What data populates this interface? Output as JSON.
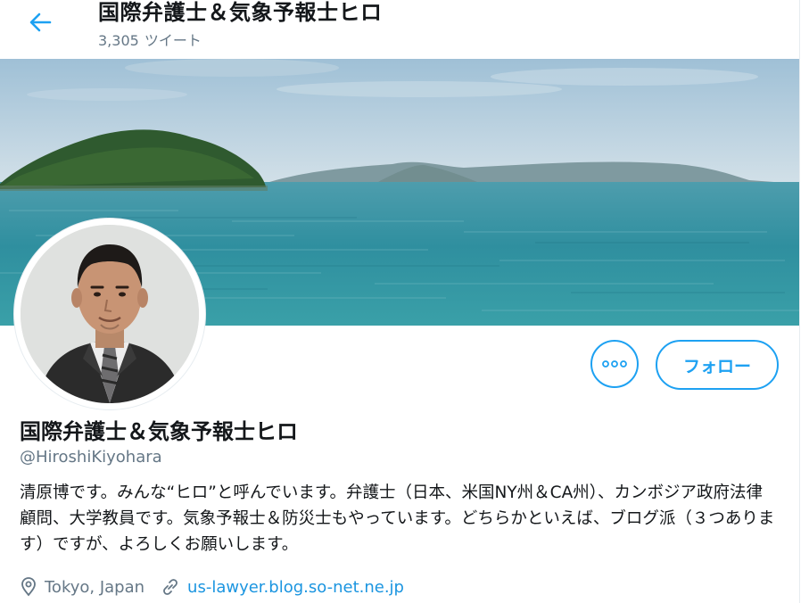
{
  "header": {
    "title": "国際弁護士＆気象予報士ヒロ",
    "tweet_count": "3,305",
    "tweet_label": "ツイート"
  },
  "profile": {
    "name": "国際弁護士＆気象予報士ヒロ",
    "handle": "@HiroshiKiyohara",
    "bio": "清原博です。みんな“ヒロ”と呼んでいます。弁護士（日本、米国NY州＆CA州）、カンボジア政府法律顧問、大学教員です。気象予報士＆防災士もやっています。どちらかといえば、ブログ派（３つあります）ですが、よろしくお願いします。",
    "location": "Tokyo, Japan",
    "website": "us-lawyer.blog.so-net.ne.jp"
  },
  "actions": {
    "follow_label": "フォロー",
    "more_icon": "more-horizontal-icon"
  },
  "colors": {
    "accent": "#1da1f2",
    "link": "#1b95e0",
    "secondary_text": "#657786",
    "primary_text": "#14171a"
  }
}
